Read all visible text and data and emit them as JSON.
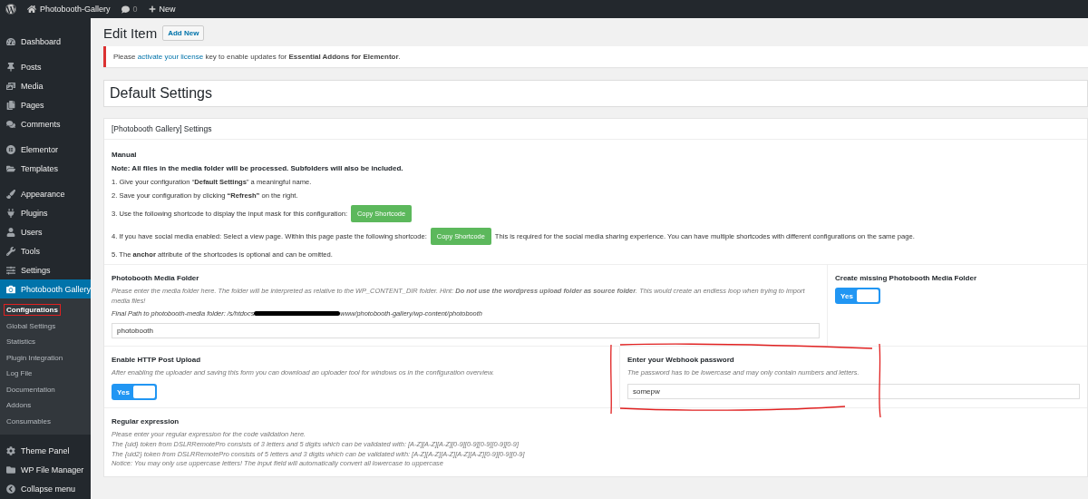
{
  "admin_bar": {
    "site_name": "Photobooth-Gallery",
    "comments_count": "0",
    "new_label": "New"
  },
  "sidebar": {
    "groups": [
      [
        {
          "label": "Dashboard",
          "selected": false
        }
      ],
      [
        {
          "label": "Posts",
          "selected": false
        },
        {
          "label": "Media",
          "selected": false
        },
        {
          "label": "Pages",
          "selected": false
        },
        {
          "label": "Comments",
          "selected": false
        }
      ],
      [
        {
          "label": "Elementor",
          "selected": false
        },
        {
          "label": "Templates",
          "selected": false
        }
      ],
      [
        {
          "label": "Appearance",
          "selected": false
        },
        {
          "label": "Plugins",
          "selected": false
        },
        {
          "label": "Users",
          "selected": false
        },
        {
          "label": "Tools",
          "selected": false
        },
        {
          "label": "Settings",
          "selected": false
        },
        {
          "label": "Photobooth Gallery",
          "selected": true,
          "submenu": [
            {
              "label": "Configurations",
              "selected": true,
              "highlighted": true
            },
            {
              "label": "Global Settings",
              "selected": false,
              "highlighted": false
            },
            {
              "label": "Statistics",
              "selected": false,
              "highlighted": false
            },
            {
              "label": "Plugin Integration",
              "selected": false,
              "highlighted": false
            },
            {
              "label": "Log File",
              "selected": false,
              "highlighted": false
            },
            {
              "label": "Documentation",
              "selected": false,
              "highlighted": false
            },
            {
              "label": "Addons",
              "selected": false,
              "highlighted": false
            },
            {
              "label": "Consumables",
              "selected": false,
              "highlighted": false
            }
          ]
        }
      ],
      [
        {
          "label": "Theme Panel",
          "selected": false
        },
        {
          "label": "WP File Manager",
          "selected": false
        },
        {
          "label": "Collapse menu",
          "selected": false
        }
      ]
    ]
  },
  "page": {
    "title": "Edit Item",
    "add_new": "Add New"
  },
  "notice": {
    "before": "Please",
    "link": "activate your license",
    "after": "key to enable updates for **Essential Addons for Elementor**."
  },
  "item_title": "Default Settings",
  "settings_panel": {
    "title": "[Photobooth Gallery] Settings",
    "manual_heading": "Manual",
    "note": "Note: All files in the media folder will be processed. Subfolders will also be included.",
    "steps": [
      {
        "text": "1. Give your configuration “**Default Settings**” a meaningful name."
      },
      {
        "text": "2. Save your configuration by clicking **“Refresh”** on the right."
      },
      {
        "text": "3. Use the following shortcode to display the input mask for this configuration:",
        "button": "Copy Shortcode"
      },
      {
        "text": "4. If you have social media enabled: Select a view page. Within this page paste the following shortcode:",
        "button": "Copy Shortcode",
        "after": "This is required for the social media sharing experience. You can have multiple shortcodes with different configurations on the same page."
      },
      {
        "text": "5. The **anchor** attribute of the shortcodes is optional and can be omitted."
      }
    ],
    "rows": [
      [
        {
          "kind": "text",
          "label": "Photobooth Media Folder",
          "help": "Please enter the media folder here. The folder will be interpreted as relative to the WP_CONTENT_DIR folder. Hint: **Do not use the wordpress upload folder as source folder**. This would create an endless loop when trying to import media files!",
          "path_label": "Final Path to photobooth-media folder: /s/htdocs",
          "path_rest": "www/photobooth-gallery/wp-content/photobooth",
          "value": "photobooth",
          "annotated": false
        },
        {
          "kind": "toggle",
          "label": "Create missing Photobooth Media Folder",
          "toggle_label": "Yes",
          "on": true
        }
      ],
      [
        {
          "kind": "toggle",
          "label": "Enable HTTP Post Upload",
          "help": "After enabling the uploader and saving this form you can download an uploader tool for windows os in the configuration overview.",
          "toggle_label": "Yes",
          "on": true
        },
        {
          "kind": "text",
          "label": "Enter your Webhook password",
          "help": "The password has to be lowercase and may only contain numbers and letters.",
          "value": "somepw",
          "annotated": true
        }
      ]
    ],
    "regex": {
      "label": "Regular expression",
      "lines": [
        "Please enter your regular expression for the code validation here.",
        "The {uid} token from DSLRRemotePro consists of 3 letters and 5 digits which can be validated with: [A-Z][A-Z][A-Z][0-9][0-9][0-9][0-9][0-9]",
        "The {uid2} token from DSLRRemotePro consists of 5 letters and 3 digits which can be validated with: [A-Z][A-Z][A-Z][A-Z][A-Z][0-9][0-9][0-9]",
        "Notice: You may only use uppercase letters! The input field will automatically convert all lowercase to uppercase"
      ]
    }
  }
}
